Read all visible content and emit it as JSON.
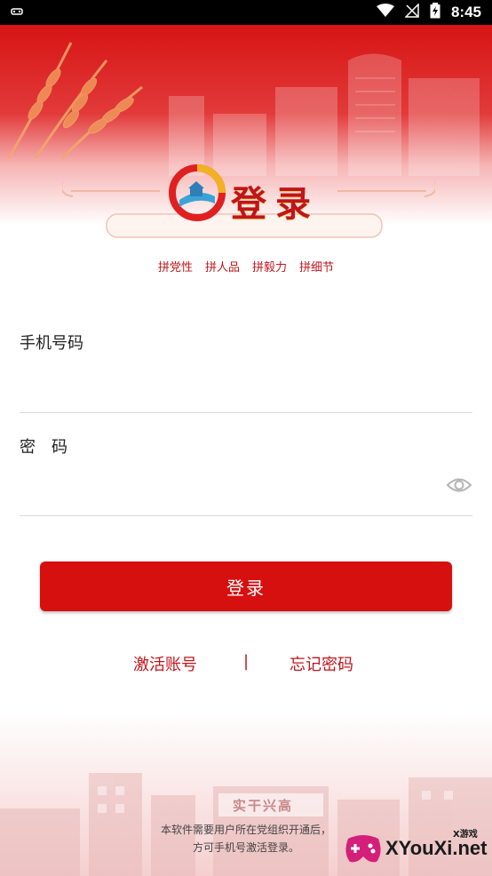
{
  "status_bar": {
    "time": "8:45"
  },
  "header": {
    "title": "登录",
    "slogans": [
      "拼党性",
      "拼人品",
      "拼毅力",
      "拼细节"
    ]
  },
  "form": {
    "phone_label": "手机号码",
    "phone_value": "",
    "password_label": "密　码",
    "password_value": ""
  },
  "actions": {
    "login_label": "登录",
    "activate_label": "激活账号",
    "separator": "|",
    "forgot_label": "忘记密码"
  },
  "footer": {
    "note_line1": "本软件需要用户所在党组织开通后，",
    "note_line2": "方可手机号激活登录。",
    "sign_text": "实干兴高"
  },
  "watermark": {
    "brand": "XYouXi.net",
    "tag": "X游戏"
  },
  "colors": {
    "brand_red": "#d60f0f",
    "accent_red": "#c0151b"
  }
}
